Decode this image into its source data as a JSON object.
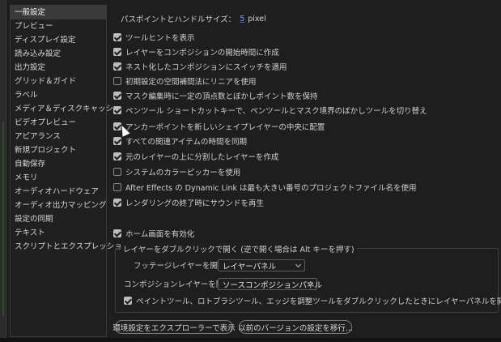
{
  "sidebar": {
    "items": [
      {
        "label": "一般設定",
        "selected": true
      },
      {
        "label": "プレビュー"
      },
      {
        "label": "ディスプレイ設定"
      },
      {
        "label": "読み込み設定"
      },
      {
        "label": "出力設定"
      },
      {
        "label": "グリッド＆ガイド"
      },
      {
        "label": "ラベル"
      },
      {
        "label": "メディア＆ディスクキャッシュ"
      },
      {
        "label": "ビデオプレビュー"
      },
      {
        "label": "アピアランス"
      },
      {
        "label": "新規プロジェクト"
      },
      {
        "label": "自動保存"
      },
      {
        "label": "メモリ"
      },
      {
        "label": "オーディオハードウェア"
      },
      {
        "label": "オーディオ出力マッピング"
      },
      {
        "label": "設定の同期"
      },
      {
        "label": "テキスト"
      },
      {
        "label": "スクリプトとエクスプレッション"
      }
    ]
  },
  "main": {
    "path_point": {
      "label": "パスポイントとハンドルサイズ：",
      "value": "5",
      "unit": "pixel"
    },
    "options": [
      {
        "label": "ツールヒントを表示",
        "checked": true
      },
      {
        "label": "レイヤーをコンポジションの開始時間に作成",
        "checked": true
      },
      {
        "label": "ネスト化したコンポジションにスイッチを適用",
        "checked": true
      },
      {
        "label": "初期設定の空間補間法にリニアを使用",
        "checked": false
      },
      {
        "label": "マスク編集時に一定の頂点数とぼかしポイント数を保持",
        "checked": true
      },
      {
        "label": "ペンツール ショートカットキーで、ペンツールとマスク境界のぼかしツールを切り替え",
        "checked": true
      },
      {
        "label": "アンカーポイントを新しいシェイプレイヤーの中央に配置",
        "checked": true
      },
      {
        "label": "すべての関連アイテムの時間を同期",
        "checked": true
      },
      {
        "label": "元のレイヤーの上に分割したレイヤーを作成",
        "checked": true
      },
      {
        "label": "システムのカラーピッカーを使用",
        "checked": false
      },
      {
        "label": "After Effects の Dynamic Link は最も大きい番号のプロジェクトファイル名を使用",
        "checked": false
      },
      {
        "label": "レンダリングの終了時にサウンドを再生",
        "checked": true
      }
    ],
    "home_screen": {
      "label": "ホーム画面を有効化",
      "checked": true
    },
    "double_click_group": {
      "title": "レイヤーをダブルクリックで開く (逆で開く場合は Alt キーを押す)",
      "footage": {
        "label": "フッテージレイヤーを開く：",
        "value": "レイヤーパネル"
      },
      "composition": {
        "label": "コンポジションレイヤーを開く：",
        "value": "ソースコンポジションパネル"
      },
      "paint_tool": {
        "label": "ペイントツール、ロトブラシツール、エッジを調整ツールをダブルクリックしたときにレイヤーパネルを開く",
        "checked": true
      }
    },
    "buttons": {
      "reveal_prefs": "環境設定をエクスプローラーで表示",
      "migrate_prev": "以前のバージョンの設定を移行..."
    }
  }
}
